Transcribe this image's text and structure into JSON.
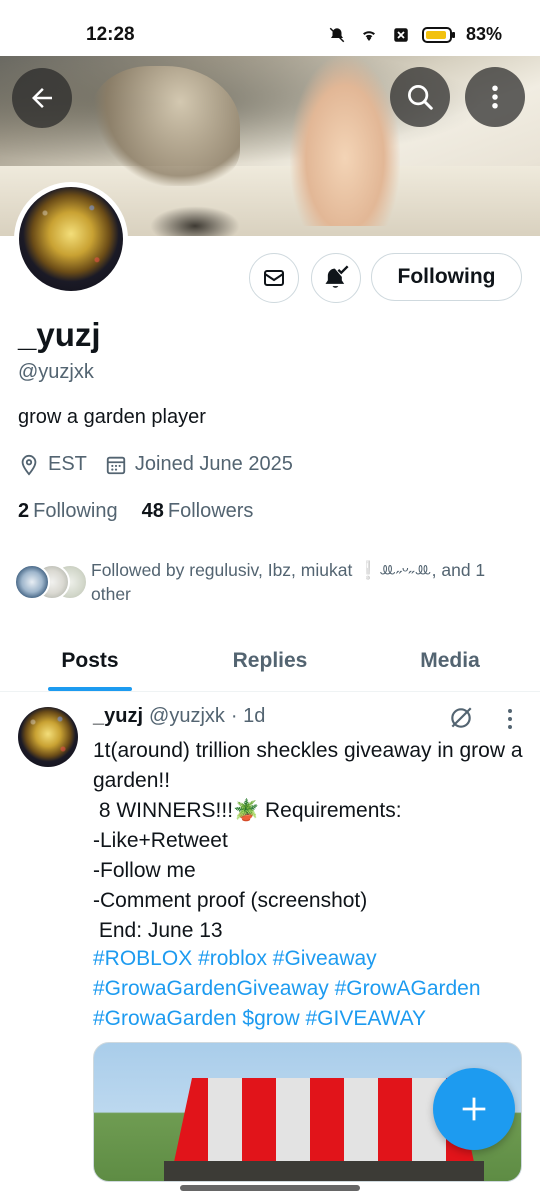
{
  "status_bar": {
    "time": "12:28",
    "battery": "83%",
    "icons": [
      "dnd-mute-icon",
      "wifi-icon",
      "data-saver-icon",
      "battery-icon"
    ]
  },
  "banner": {
    "icons": {
      "back": "arrow-left-icon",
      "search": "search-icon",
      "more": "more-vertical-icon"
    }
  },
  "profile": {
    "display_name": "_yuzj",
    "handle": "@yuzjxk",
    "bio": "grow a garden player",
    "location": "EST",
    "joined": "Joined June 2025",
    "following_count": "2",
    "following_label": "Following",
    "followers_count": "48",
    "followers_label": "Followers",
    "followed_by": "Followed by regulusiv, Ibz, miukat ❕ꔛ˶ᵕ˶ꔛ, and 1 other"
  },
  "actions": {
    "following_button": "Following",
    "icons": {
      "message": "envelope-icon",
      "notify": "bell-check-icon"
    }
  },
  "tabs": [
    {
      "label": "Posts",
      "active": true
    },
    {
      "label": "Replies",
      "active": false
    },
    {
      "label": "Media",
      "active": false
    }
  ],
  "post": {
    "name": "_yuzj",
    "handle": "@yuzjxk",
    "time": "· 1d",
    "body": "1t(around) trillion sheckles giveaway in grow a garden!!\n 8 WINNERS!!!🪴 Requirements:\n-Like+Retweet\n-Follow me\n-Comment proof (screenshot)\n End: June 13",
    "tags": [
      "#ROBLOX",
      "#roblox",
      "#Giveaway",
      "#GrowaGardenGiveaway",
      "#GrowAGarden",
      "#GrowaGarden",
      "$grow",
      "#GIVEAWAY"
    ]
  },
  "colors": {
    "accent": "#1d9bf0",
    "text": "#0f1419",
    "secondary": "#536471",
    "border": "#cfd9de"
  }
}
